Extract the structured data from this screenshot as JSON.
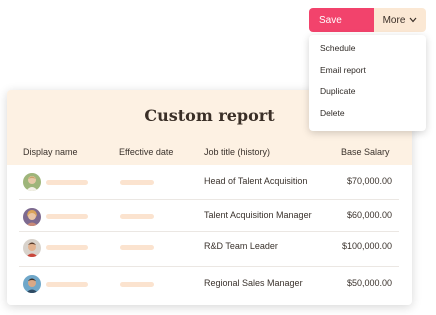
{
  "toolbar": {
    "save_label": "Save",
    "more_label": "More",
    "menu": [
      "Schedule",
      "Email report",
      "Duplicate",
      "Delete"
    ]
  },
  "report": {
    "title": "Custom report",
    "columns": [
      "Display name",
      "Effective date",
      "Job title (history)",
      "Base Salary"
    ],
    "rows": [
      {
        "job_title": "Head of Talent Acquisition",
        "salary": "$70,000.00"
      },
      {
        "job_title": "Talent Acquisition Manager",
        "salary": "$60,000.00"
      },
      {
        "job_title": "R&D Team Leader",
        "salary": "$100,000.00"
      },
      {
        "job_title": "Regional Sales Manager",
        "salary": "$50,000.00"
      }
    ]
  },
  "colors": {
    "save": "#f2436c",
    "more": "#fbe8d4",
    "header_bg": "#fdf1e3",
    "placeholder": "#fbe3cf"
  },
  "icons": {
    "more": "chevron-down-icon",
    "avatar": "avatar"
  }
}
